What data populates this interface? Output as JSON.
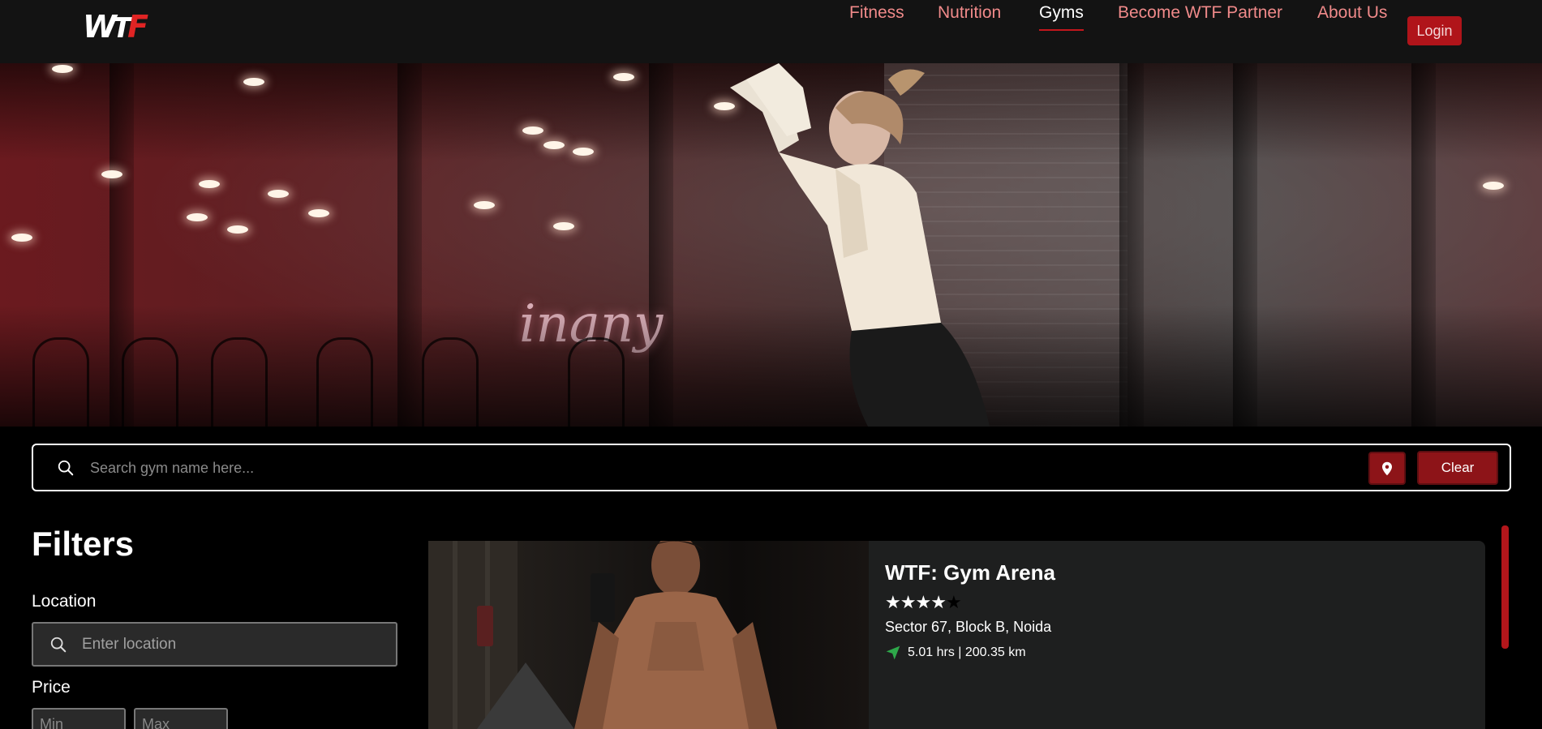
{
  "nav": {
    "logo_text": "WTF",
    "links": [
      "Fitness",
      "Nutrition",
      "Gyms",
      "Become WTF Partner",
      "About Us"
    ],
    "active": "Gyms",
    "login_label": "Login",
    "colors": {
      "background": "#131313",
      "link": "#f08a8a",
      "active": "#ffffff",
      "accent": "#c4161c"
    }
  },
  "hero": {
    "neon_text": "inany"
  },
  "search": {
    "placeholder": "Search gym name here...",
    "value": "",
    "location_icon": "map-pin-icon",
    "clear_label": "Clear"
  },
  "filters": {
    "title": "Filters",
    "location_label": "Location",
    "location_placeholder": "Enter location",
    "price_label": "Price",
    "price_min_placeholder": "Min",
    "price_max_placeholder": "Max"
  },
  "gyms": [
    {
      "name": "WTF: Gym Arena",
      "rating": 4,
      "rating_max": 5,
      "address": "Sector 67, Block B, Noida",
      "distance": "5.01 hrs | 200.35 km",
      "distance_icon": "navigation-arrow-icon"
    }
  ],
  "theme": {
    "brand_red": "#b0141a",
    "button_red": "#8d1418",
    "card_bg": "#1e1f1f",
    "nav_arrow_green": "#2ea84a"
  }
}
